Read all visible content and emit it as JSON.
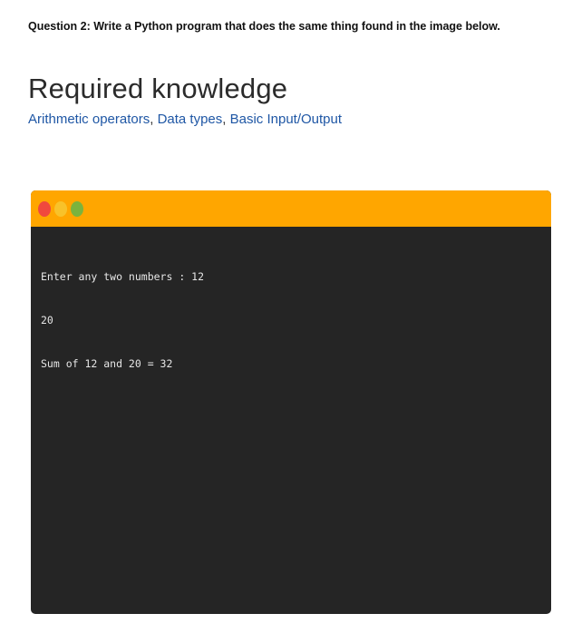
{
  "question": {
    "text": "Question 2: Write a Python program that does the same thing found in the image below."
  },
  "section": {
    "heading": "Required knowledge",
    "topics": [
      {
        "label": "Arithmetic operators"
      },
      {
        "label": "Data types"
      },
      {
        "label": "Basic Input/Output"
      }
    ],
    "separator": ", "
  },
  "terminal_window": {
    "colors": {
      "titlebar": "#ffa600",
      "background": "#252525",
      "text": "#e6e6e6",
      "close_dot": "#f0493e",
      "minimize_dot": "#f8c22a",
      "maximize_dot": "#7bb33d"
    },
    "output_lines": [
      "Enter any two numbers : 12",
      "20",
      "Sum of 12 and 20 = 32"
    ]
  }
}
